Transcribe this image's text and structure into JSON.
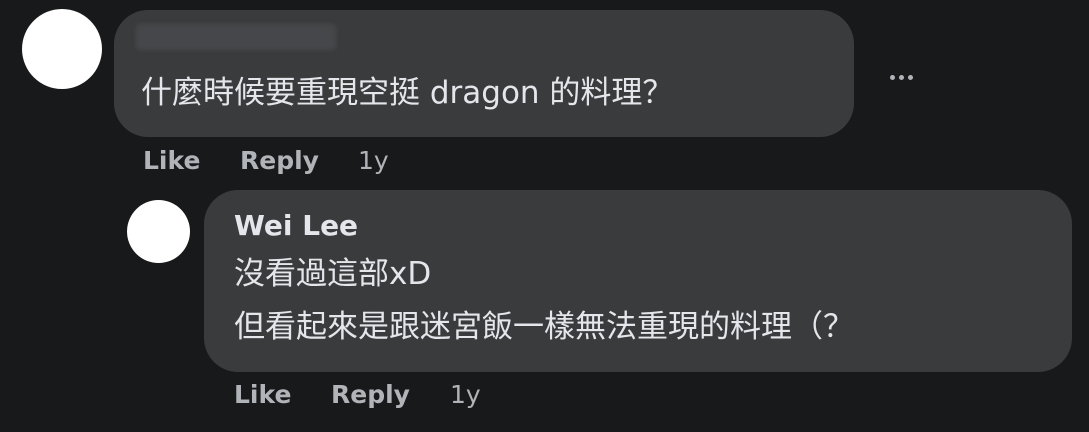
{
  "main_comment": {
    "text": "什麼時候要重現空挺 dragon 的料理？",
    "actions": {
      "like": "Like",
      "reply": "Reply",
      "time": "1y"
    }
  },
  "reply_comment": {
    "author": "Wei Lee",
    "line1": "沒看過這部xD",
    "line2": "但看起來是跟迷宮飯一樣無法重現的料理（？",
    "actions": {
      "like": "Like",
      "reply": "Reply",
      "time": "1y"
    }
  },
  "icons": {
    "more": "more-options-icon"
  }
}
